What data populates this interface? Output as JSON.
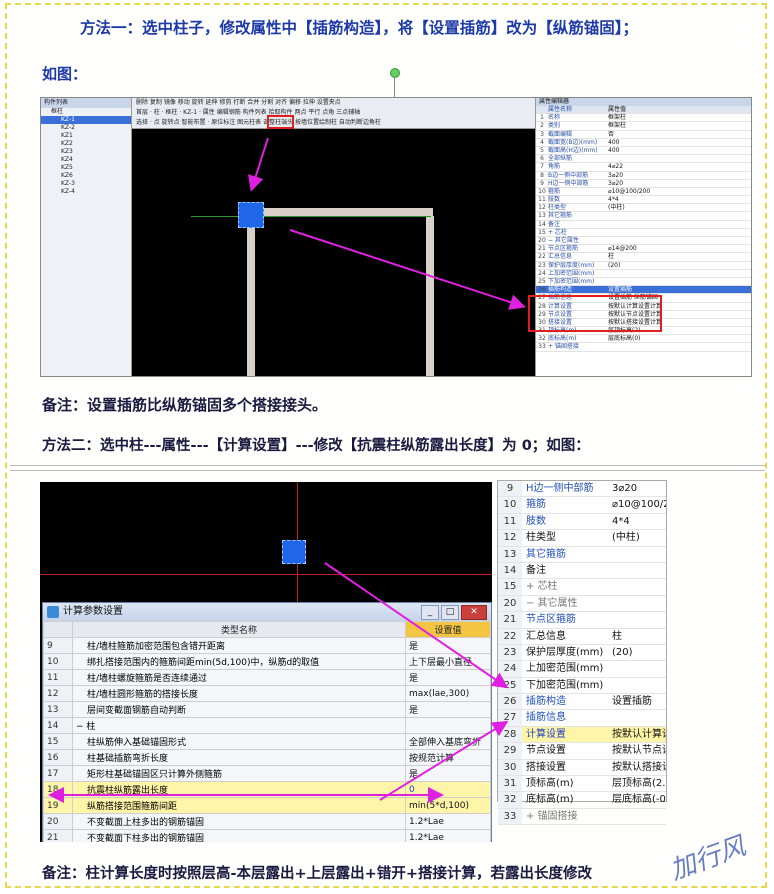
{
  "heading1": "方法一：选中柱子，修改属性中【插筋构造】，将【设置插筋】改为【纵筋锚固】；",
  "as_shown1": "如图：",
  "note1_label": "备注：",
  "note1_text": "设置插筋比纵筋锚固多个搭接接头。",
  "heading2": "方法二：选中柱---属性---【计算设置】---修改【抗震柱纵筋露出长度】为 0；如图：",
  "note2_label": "备注：",
  "note2_text": "柱计算长度时按照层高-本层露出+上层露出+错开+搭接计算，若露出长度修改",
  "watermark": "加行风",
  "shot1": {
    "tree_title": "构件列表",
    "tree_items": [
      "框柱",
      "KZ-1",
      "KZ-2",
      "KZ1",
      "KZ2",
      "KZ3",
      "KZ4",
      "KZ5",
      "KZ6",
      "KZ-3",
      "KZ-4"
    ],
    "toolbar_row1": "删除 复制 镜像 移动 旋转 延伸 修剪 打断 合并 分割 对齐 偏移 拉伸 设置夹点",
    "toolbar_row2": "首层 · 柱 · 框柱 · KZ-1 · 属性 编辑钢筋 构件列表 拾取构件 两点 平行 点角 三点辅轴",
    "toolbar_row3": "选择 · 点 旋转点 智能布置 · 原位标注 图元柱表 调整柱端头 按墙位置绘制柱 自动判断边角柱",
    "props_title": "属性编辑器",
    "props_head": [
      "属性名称",
      "属性值"
    ],
    "props_rows": [
      [
        "1",
        "名称",
        "框架柱"
      ],
      [
        "2",
        "类别",
        "框架柱"
      ],
      [
        "3",
        "截面编辑",
        "否"
      ],
      [
        "4",
        "截面宽(B边)(mm)",
        "400"
      ],
      [
        "5",
        "截面高(H边)(mm)",
        "400"
      ],
      [
        "6",
        "全部纵筋",
        ""
      ],
      [
        "7",
        "角筋",
        "4⌀22"
      ],
      [
        "8",
        "B边一侧中部筋",
        "3⌀20"
      ],
      [
        "9",
        "H边一侧中部筋",
        "3⌀20"
      ],
      [
        "10",
        "箍筋",
        "⌀10@100/200"
      ],
      [
        "11",
        "肢数",
        "4*4"
      ],
      [
        "12",
        "柱类型",
        "(中柱)"
      ],
      [
        "13",
        "其它箍筋",
        ""
      ],
      [
        "14",
        "备注",
        ""
      ],
      [
        "15",
        "+ 芯柱",
        ""
      ],
      [
        "20",
        "− 其它属性",
        ""
      ],
      [
        "21",
        "节点区箍筋",
        "⌀14@200"
      ],
      [
        "22",
        "汇总信息",
        "柱"
      ],
      [
        "23",
        "保护层厚度(mm)",
        "(20)"
      ],
      [
        "24",
        "上加密范围(mm)",
        ""
      ],
      [
        "25",
        "下加密范围(mm)",
        ""
      ],
      [
        "26",
        "插筋构造",
        "设置插筋"
      ],
      [
        "27",
        "插筋信息",
        "设置插筋 纵筋锚固"
      ],
      [
        "28",
        "计算设置",
        "按默认计算设置计算"
      ],
      [
        "29",
        "节点设置",
        "按默认节点设置计算"
      ],
      [
        "30",
        "搭接设置",
        "按默认搭接设置计算"
      ],
      [
        "31",
        "顶标高(m)",
        "层顶标高(2)"
      ],
      [
        "32",
        "底标高(m)",
        "层底标高(0)"
      ],
      [
        "33",
        "+ 锚固搭接",
        ""
      ]
    ]
  },
  "dialog": {
    "title": "计算参数设置",
    "col_name": "类型名称",
    "col_value": "设置值",
    "rows": [
      [
        "9",
        "柱/墙柱箍筋加密范围包含错开距离",
        "是"
      ],
      [
        "10",
        "绑扎搭接范围内的箍筋间距min(5d,100)中，纵筋d的取值",
        "上下层最小直径"
      ],
      [
        "11",
        "柱/墙柱螺旋箍筋是否连续通过",
        "是"
      ],
      [
        "12",
        "柱/墙柱圆形箍筋的搭接长度",
        "max(lae,300)"
      ],
      [
        "13",
        "层间变截面钢筋自动判断",
        "是"
      ],
      [
        "14",
        "− 柱",
        ""
      ],
      [
        "15",
        "柱纵筋伸入基础锚固形式",
        "全部伸入基底弯折"
      ],
      [
        "16",
        "柱基础插筋弯折长度",
        "按规范计算"
      ],
      [
        "17",
        "矩形柱基础锚固区只计算外侧箍筋",
        "是"
      ],
      [
        "18",
        "抗震柱纵筋露出长度",
        "0"
      ],
      [
        "19",
        "纵筋搭接范围箍筋间距",
        "min(5*d,100)"
      ],
      [
        "20",
        "不变截面上柱多出的钢筋锚固",
        "1.2*Lae"
      ],
      [
        "21",
        "不变截面下柱多出的钢筋锚固",
        "1.2*Lae"
      ]
    ]
  },
  "props2": {
    "rows": [
      [
        "9",
        "H边一侧中部筋",
        "3⌀20"
      ],
      [
        "10",
        "箍筋",
        "⌀10@100/20"
      ],
      [
        "11",
        "肢数",
        "4*4"
      ],
      [
        "12",
        "柱类型",
        "(中柱)"
      ],
      [
        "13",
        "其它箍筋",
        ""
      ],
      [
        "14",
        "备注",
        ""
      ],
      [
        "15",
        "+ 芯柱",
        ""
      ],
      [
        "20",
        "− 其它属性",
        ""
      ],
      [
        "21",
        "节点区箍筋",
        ""
      ],
      [
        "22",
        "汇总信息",
        "柱"
      ],
      [
        "23",
        "保护层厚度(mm)",
        "(20)"
      ],
      [
        "24",
        "上加密范围(mm)",
        ""
      ],
      [
        "25",
        "下加密范围(mm)",
        ""
      ],
      [
        "26",
        "插筋构造",
        "设置插筋"
      ],
      [
        "27",
        "插筋信息",
        ""
      ],
      [
        "28",
        "计算设置",
        "按默认计算设"
      ],
      [
        "29",
        "节点设置",
        "按默认节点设"
      ],
      [
        "30",
        "搭接设置",
        "按默认搭接设"
      ],
      [
        "31",
        "顶标高(m)",
        "层顶标高(2."
      ],
      [
        "32",
        "底标高(m)",
        "层底标高(-0"
      ],
      [
        "33",
        "+ 锚固搭接",
        ""
      ]
    ]
  },
  "colors": {
    "heading": "#1e3aa8",
    "arrow": "#e020e0",
    "highlight": "#fff5a8",
    "frame": "#e8d84a"
  }
}
